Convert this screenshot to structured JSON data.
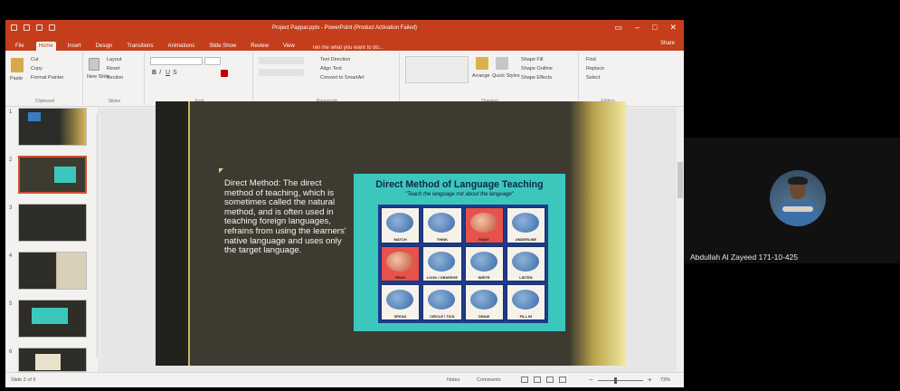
{
  "window": {
    "title": "Project Pappar.pptx - PowerPoint (Product Activation Failed)",
    "share_label": "Share"
  },
  "tabs": [
    "File",
    "Home",
    "Insert",
    "Design",
    "Transitions",
    "Animations",
    "Slide Show",
    "Review",
    "View"
  ],
  "tell_me": "Tell me what you want to do...",
  "ribbon": {
    "clipboard": {
      "paste": "Paste",
      "cut": "Cut",
      "copy": "Copy",
      "format_painter": "Format Painter",
      "label": "Clipboard"
    },
    "slides": {
      "new_slide": "New Slide",
      "layout": "Layout",
      "reset": "Reset",
      "section": "Section",
      "label": "Slides"
    },
    "font": {
      "label": "Font"
    },
    "paragraph": {
      "text_direction": "Text Direction",
      "align_text": "Align Text",
      "convert": "Convert to SmartArt",
      "label": "Paragraph"
    },
    "drawing": {
      "arrange": "Arrange",
      "quick_styles": "Quick Styles",
      "shape_fill": "Shape Fill",
      "shape_outline": "Shape Outline",
      "shape_effects": "Shape Effects",
      "label": "Drawing"
    },
    "editing": {
      "find": "Find",
      "replace": "Replace",
      "select": "Select",
      "label": "Editing"
    }
  },
  "thumbnails": [
    {
      "num": "1"
    },
    {
      "num": "2"
    },
    {
      "num": "3"
    },
    {
      "num": "4"
    },
    {
      "num": "5"
    },
    {
      "num": "6"
    }
  ],
  "slide": {
    "body_text": "Direct Method: The direct method of teaching, which is sometimes called the natural method, and is often used in teaching foreign languages, refrains from using the learners' native language and uses only the target language.",
    "poster_title": "Direct Method of Language Teaching",
    "poster_subtitle": "\"Teach the language not about the language\"",
    "cards": [
      "MATCH",
      "THINK",
      "PAINT",
      "UNDERLINE",
      "READ",
      "LOOK / OBSERVE",
      "WRITE",
      "LISTEN",
      "SPEAK",
      "CIRCLE / TICK",
      "DRAW",
      "FILL IN"
    ]
  },
  "status": {
    "slide_of": "Slide 2 of 6",
    "notes": "Notes",
    "comments": "Comments",
    "zoom": "73%"
  },
  "participant": {
    "name": "Abdullah Al Zayeed 171-10-425"
  }
}
